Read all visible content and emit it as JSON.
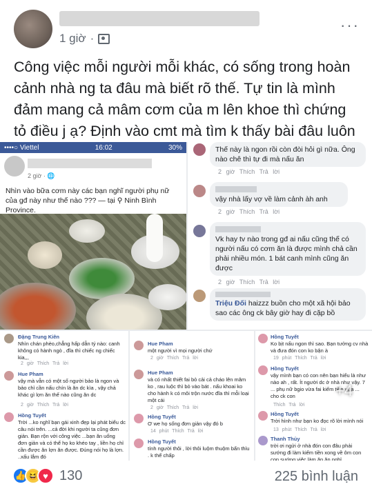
{
  "post": {
    "time": "1 giờ",
    "more": "···",
    "text": "Công việc mỗi người mỗi khác, có sống trong hoàn cảnh nhà ng ta đâu mà biết rõ thế. Tự tin là mình đảm mang cả mâm cơm của m lên khoe thì chứng tỏ điều j ạ? Định vào cmt mà tìm k thấy bài đâu luôn oy😂"
  },
  "shot1": {
    "carrier": "••••○ Viettel",
    "clock": "16:02",
    "battery": "30%",
    "time": "2 giờ · 🌐",
    "text": "Nhìn vào bữa cơm này các bạn nghĩ người phụ nữ của gđ này như thế nào ??? — tại ⚲ Ninh Bình Province."
  },
  "shot2": {
    "c1_text": "Thế này là ngon rồi còn đòi hỏi gì nữa. Ông nào chê thì tự đi mà nấu ăn",
    "c1_act": "2 giờ  Thích  Trả lời",
    "c2_text": "vậy nhà lấy vợ về làm cảnh àh anh",
    "c2_act": "2 giờ  Thích  Trả lời",
    "c3_text": "Vk hay tv nào trong gđ ai nấu cũng thế có người nấu có cơm ăn là được mình chả cần phải nhiều món. 1 bát canh mình cũng ăn được",
    "c3_act": "2 giờ  Thích  Trả lời",
    "c4_name": "Triệu Đối",
    "c4_text": "haizzz buồn cho một xã hội bảo sao các ông ck bây giờ hay đi cặp bồ",
    "c4_act": "2 giờ  Thích  Trả lời"
  },
  "left": {
    "a_name": "Đặng Trung Kiên",
    "a_text": "Nhìn chán phèo,chẳng hấp dẫn tý nào: canh không có hành ngò , đĩa thì chiếc ng chiếc kia,,,",
    "a_act": "2 giờ  Thích  Trả lời",
    "b_name": "Hue Pham",
    "b_text": "vậy mà vẫn có một số người bảo là ngon và bảo chỉ cần nấu chín là ăn dc kìa , vậy chả khác gì lợn ăn thế nào cũng ăn dc",
    "b_act": "2 giờ  Thích  Trả lời",
    "c_name": "Hồng Tuyết",
    "c_text": "Trời ...ko nghĩ bạn gái xinh đẹp lại phát biểu dc câu nói trên. ...cả đời khi người ta cũng đơn giản. Bạn rộn với công việc ...bạn ăn uống đơn giản và có thể họ ko khéo tay , liền họ chỉ cần được ăn lợn ăn được. Đúng nói họ là lợn. ..xấu lắm đó",
    "c_act": "2 giờ  Thích  Trả lời"
  },
  "mid": {
    "a_name": "Hue Pham",
    "a_text": "một người vì mọi người chứ",
    "a_act": "2 giờ  Thích  Trả lời",
    "b_name": "Hue Pham",
    "b_text": "và có nhất thiết fai bỏ cải cả cháo lên mâm ko , rau luộc thì bỏ vào bát . nấu khoai ko cho hành k có môi trộn nước đĩa thì mỗi loại một cái",
    "b_act": "2 giờ  Thích  Trả lời",
    "c_name": "Hồng Tuyết",
    "c_text": "Ơ we họ sống đơn giản vậy đó b",
    "c_act": "14 phút  Thích  Trả lời",
    "d_name": "Hồng Tuyết",
    "d_text": "tính người thôi , lời thôi luộm thuộm bẩn thỉu . k thể chấp",
    "d_act": ""
  },
  "right": {
    "a_name": "Hồng Tuyết",
    "a_text": "Ko bịt nấu ngon thì sao. Bạn tưởng cv nhà và đưa đón con ko bận à",
    "a_act": "19 phút  Thích  Trả lời",
    "b_name": "Hồng Tuyết",
    "b_text": "vậy mình bạn có con nên bạn hiểu là như nào ah , rất. Ít người dc ở nhà như vậy. 7 ... phụ nữ bgio vừa fai kiếm tiền vừa ... cho ck con",
    "b_act": "Thích  Trả lời",
    "badge": "+4",
    "c_name": "Hồng Tuyết",
    "c_text": "Trời hình như bạn ko đọc rõ lời mình nói",
    "c_act": "13 phút  Thích  Trả lời",
    "d_name": "Thanh Thủy",
    "d_text": "trời ơi ngửi ở nhà đón con đâu phải sướng đi làm kiếm tiền xong về ôm con con sướng việc làm ăn ăn nghỉ",
    "d_act": ""
  },
  "footer": {
    "reaction_count": "130",
    "comment_count": "225 bình luận"
  },
  "colors": {
    "fb_blue": "#3b5998",
    "name_blue": "#385898",
    "muted": "#606770"
  }
}
